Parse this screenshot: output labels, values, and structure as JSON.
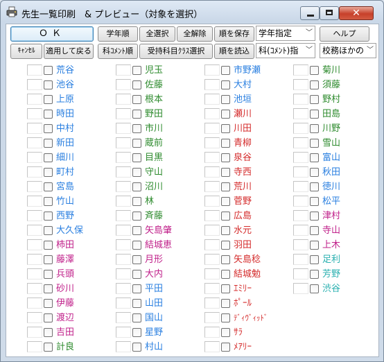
{
  "window": {
    "title": "先生一覧印刷　& プレビュー（対象を選択）"
  },
  "toolbar": {
    "ok": "ＯＫ",
    "grade_order": "学年順",
    "select_all": "全選択",
    "deselect_all": "全解除",
    "save_order": "順を保存",
    "grade_dropdown": "学年指定",
    "help": "ヘルプ",
    "cancel": "ｷｬﾝｾﾙ",
    "apply_back": "適用して戻る",
    "comment_order": "科ｺﾒﾝﾄ順",
    "class_select": "受持科目ｸﾗｽ選択",
    "load_order": "順を読込",
    "subject_dropdown": "科(ｺﾒﾝﾄ)指",
    "school_dropdown": "校務ほかの"
  },
  "columns": [
    [
      {
        "name": "荒谷",
        "color": "#2a7fe0"
      },
      {
        "name": "池谷",
        "color": "#2a7fe0"
      },
      {
        "name": "上原",
        "color": "#2a7fe0"
      },
      {
        "name": "時田",
        "color": "#2a7fe0"
      },
      {
        "name": "中村",
        "color": "#2a7fe0"
      },
      {
        "name": "新田",
        "color": "#2a7fe0"
      },
      {
        "name": "細川",
        "color": "#2a7fe0"
      },
      {
        "name": "町村",
        "color": "#2a7fe0"
      },
      {
        "name": "宮島",
        "color": "#2a7fe0"
      },
      {
        "name": "竹山",
        "color": "#2a7fe0"
      },
      {
        "name": "西野",
        "color": "#2a7fe0"
      },
      {
        "name": "大久保",
        "color": "#2a7fe0"
      },
      {
        "name": "柿田",
        "color": "#c0208a"
      },
      {
        "name": "藤澤",
        "color": "#c0208a"
      },
      {
        "name": "兵頭",
        "color": "#c0208a"
      },
      {
        "name": "砂川",
        "color": "#c0208a"
      },
      {
        "name": "伊藤",
        "color": "#c0208a"
      },
      {
        "name": "渡辺",
        "color": "#c0208a"
      },
      {
        "name": "吉田",
        "color": "#c0208a"
      },
      {
        "name": "計良",
        "color": "#2e8b2e"
      }
    ],
    [
      {
        "name": "児玉",
        "color": "#2e8b2e"
      },
      {
        "name": "佐藤",
        "color": "#2e8b2e"
      },
      {
        "name": "根本",
        "color": "#2e8b2e"
      },
      {
        "name": "野田",
        "color": "#2e8b2e"
      },
      {
        "name": "市川",
        "color": "#2e8b2e"
      },
      {
        "name": "蔵前",
        "color": "#2e8b2e"
      },
      {
        "name": "目黒",
        "color": "#2e8b2e"
      },
      {
        "name": "守山",
        "color": "#2e8b2e"
      },
      {
        "name": "沼川",
        "color": "#2e8b2e"
      },
      {
        "name": "林",
        "color": "#2e8b2e"
      },
      {
        "name": "斉藤",
        "color": "#2e8b2e"
      },
      {
        "name": "矢島肇",
        "color": "#c0208a"
      },
      {
        "name": "結城恵",
        "color": "#c0208a"
      },
      {
        "name": "月形",
        "color": "#c0208a"
      },
      {
        "name": "大内",
        "color": "#c0208a"
      },
      {
        "name": "平田",
        "color": "#2a7fe0"
      },
      {
        "name": "山田",
        "color": "#2a7fe0"
      },
      {
        "name": "国山",
        "color": "#2a7fe0"
      },
      {
        "name": "星野",
        "color": "#2a7fe0"
      },
      {
        "name": "村山",
        "color": "#2a7fe0"
      }
    ],
    [
      {
        "name": "市野瀬",
        "color": "#2a7fe0"
      },
      {
        "name": "大村",
        "color": "#2a7fe0"
      },
      {
        "name": "池垣",
        "color": "#2a7fe0"
      },
      {
        "name": "瀬川",
        "color": "#d42b2b"
      },
      {
        "name": "川田",
        "color": "#d42b2b"
      },
      {
        "name": "青柳",
        "color": "#d42b2b"
      },
      {
        "name": "泉谷",
        "color": "#d42b2b"
      },
      {
        "name": "寺西",
        "color": "#d42b2b"
      },
      {
        "name": "荒川",
        "color": "#d42b2b"
      },
      {
        "name": "菅野",
        "color": "#d42b2b"
      },
      {
        "name": "広島",
        "color": "#d42b2b"
      },
      {
        "name": "水元",
        "color": "#d42b2b"
      },
      {
        "name": "羽田",
        "color": "#d42b2b"
      },
      {
        "name": "矢島稔",
        "color": "#d42b2b"
      },
      {
        "name": "結城勉",
        "color": "#d42b2b"
      },
      {
        "name": "ｴﾐﾘｰ",
        "color": "#d42b2b"
      },
      {
        "name": "ﾎﾟｰﾙ",
        "color": "#d42b2b"
      },
      {
        "name": "ﾃﾞｨｳﾞｨｯﾄﾞ",
        "color": "#d42b2b",
        "small": true
      },
      {
        "name": "ｻﾗ",
        "color": "#d42b2b"
      },
      {
        "name": "ﾒｱﾘｰ",
        "color": "#d42b2b"
      }
    ],
    [
      {
        "name": "菊川",
        "color": "#2e8b2e"
      },
      {
        "name": "須藤",
        "color": "#2e8b2e"
      },
      {
        "name": "野村",
        "color": "#2e8b2e"
      },
      {
        "name": "田島",
        "color": "#2e8b2e"
      },
      {
        "name": "川野",
        "color": "#2e8b2e"
      },
      {
        "name": "雪山",
        "color": "#2e8b2e"
      },
      {
        "name": "富山",
        "color": "#2a7fe0"
      },
      {
        "name": "秋田",
        "color": "#2a7fe0"
      },
      {
        "name": "徳川",
        "color": "#2a7fe0"
      },
      {
        "name": "松平",
        "color": "#2a7fe0"
      },
      {
        "name": "津村",
        "color": "#c0208a"
      },
      {
        "name": "寺山",
        "color": "#c0208a"
      },
      {
        "name": "上木",
        "color": "#c0208a"
      },
      {
        "name": "足利",
        "color": "#2ab0b0"
      },
      {
        "name": "芳野",
        "color": "#2ab0b0"
      },
      {
        "name": "渋谷",
        "color": "#2ab0b0"
      }
    ]
  ]
}
